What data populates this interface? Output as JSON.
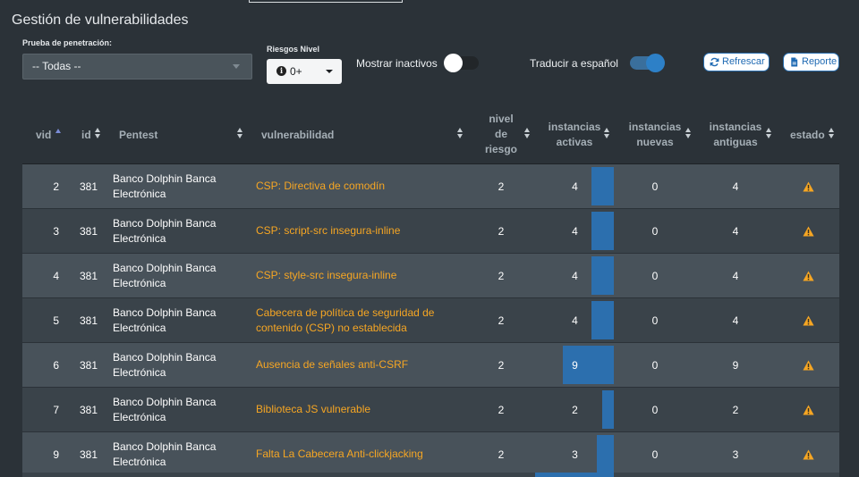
{
  "page": {
    "title": "Gestión de vulnerabilidades"
  },
  "filters": {
    "pentest_label": "Prueba de penetración:",
    "pentest_value": "-- Todas --",
    "risk_label": "Riesgos Nivel",
    "risk_value": "0+",
    "show_inactive_label": "Mostrar inactivos",
    "show_inactive_on": false,
    "translate_label": "Traducir a español",
    "translate_on": true
  },
  "buttons": {
    "refresh": "Refrescar",
    "report": "Reporte"
  },
  "colors": {
    "background": "#2b3238",
    "accent": "#2c6fae",
    "vuln_text": "#f6a623",
    "warning": "#f6a623"
  },
  "table": {
    "headers": {
      "vid": "vid",
      "id": "id",
      "pentest": "Pentest",
      "vulnerability": "vulnerabilidad",
      "risk_level": [
        "nivel",
        "de",
        "riesgo"
      ],
      "active": [
        "instancias",
        "activas"
      ],
      "new": [
        "instancias",
        "nuevas"
      ],
      "old": [
        "instancias",
        "antiguas"
      ],
      "status": "estado"
    },
    "rows": [
      {
        "vid": "2",
        "id": "381",
        "pentest": [
          "Banco Dolphin Banca",
          "Electrónica"
        ],
        "vulnerability": [
          "CSP: Directiva de comodín"
        ],
        "risk": "2",
        "active": 4,
        "new": "0",
        "old": "4",
        "status_icon": "warning-icon"
      },
      {
        "vid": "3",
        "id": "381",
        "pentest": [
          "Banco Dolphin Banca",
          "Electrónica"
        ],
        "vulnerability": [
          "CSP: script-src insegura-inline"
        ],
        "risk": "2",
        "active": 4,
        "new": "0",
        "old": "4",
        "status_icon": "warning-icon"
      },
      {
        "vid": "4",
        "id": "381",
        "pentest": [
          "Banco Dolphin Banca",
          "Electrónica"
        ],
        "vulnerability": [
          "CSP: style-src insegura-inline"
        ],
        "risk": "2",
        "active": 4,
        "new": "0",
        "old": "4",
        "status_icon": "warning-icon"
      },
      {
        "vid": "5",
        "id": "381",
        "pentest": [
          "Banco Dolphin Banca",
          "Electrónica"
        ],
        "vulnerability": [
          "Cabecera de política de seguridad de",
          "contenido (CSP) no establecida"
        ],
        "risk": "2",
        "active": 4,
        "new": "0",
        "old": "4",
        "status_icon": "warning-icon"
      },
      {
        "vid": "6",
        "id": "381",
        "pentest": [
          "Banco Dolphin Banca",
          "Electrónica"
        ],
        "vulnerability": [
          "Ausencia de señales anti-CSRF"
        ],
        "risk": "2",
        "active": 9,
        "new": "0",
        "old": "9",
        "status_icon": "warning-icon"
      },
      {
        "vid": "7",
        "id": "381",
        "pentest": [
          "Banco Dolphin Banca",
          "Electrónica"
        ],
        "vulnerability": [
          "Biblioteca JS vulnerable"
        ],
        "risk": "2",
        "active": 2,
        "new": "0",
        "old": "2",
        "status_icon": "warning-icon"
      },
      {
        "vid": "9",
        "id": "381",
        "pentest": [
          "Banco Dolphin Banca",
          "Electrónica"
        ],
        "vulnerability": [
          "Falta La Cabecera Anti-clickjacking"
        ],
        "risk": "2",
        "active": 3,
        "new": "0",
        "old": "3",
        "status_icon": "warning-icon"
      }
    ]
  }
}
